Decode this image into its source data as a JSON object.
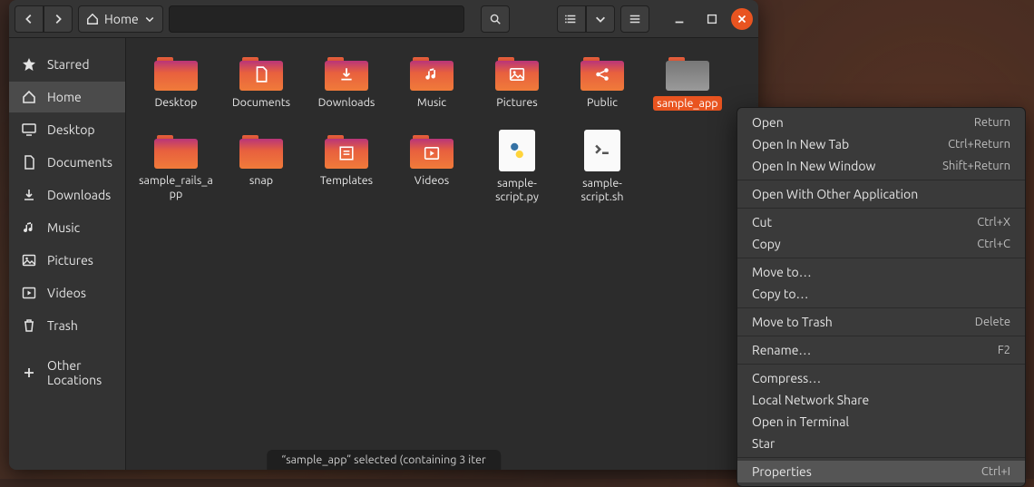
{
  "path_label": "Home",
  "sidebar": [
    {
      "key": "starred",
      "label": "Starred",
      "icon": "star",
      "active": false
    },
    {
      "key": "home",
      "label": "Home",
      "icon": "home",
      "active": true
    },
    {
      "key": "desktop",
      "label": "Desktop",
      "icon": "desktop",
      "active": false
    },
    {
      "key": "documents",
      "label": "Documents",
      "icon": "doc",
      "active": false
    },
    {
      "key": "downloads",
      "label": "Downloads",
      "icon": "down",
      "active": false
    },
    {
      "key": "music",
      "label": "Music",
      "icon": "music",
      "active": false
    },
    {
      "key": "pictures",
      "label": "Pictures",
      "icon": "picture",
      "active": false
    },
    {
      "key": "videos",
      "label": "Videos",
      "icon": "video",
      "active": false
    },
    {
      "key": "trash",
      "label": "Trash",
      "icon": "trash",
      "active": false
    },
    {
      "key": "other",
      "label": "Other Locations",
      "icon": "plus",
      "active": false,
      "section": true
    }
  ],
  "files": [
    {
      "name": "Desktop",
      "type": "folder"
    },
    {
      "name": "Documents",
      "type": "folder",
      "action": "doc"
    },
    {
      "name": "Downloads",
      "type": "folder",
      "action": "down"
    },
    {
      "name": "Music",
      "type": "folder",
      "action": "music"
    },
    {
      "name": "Pictures",
      "type": "folder",
      "action": "picture"
    },
    {
      "name": "Public",
      "type": "folder",
      "action": "share"
    },
    {
      "name": "sample_app",
      "type": "folder",
      "selected": true
    },
    {
      "name": "sample_rails_app",
      "type": "folder"
    },
    {
      "name": "snap",
      "type": "folder"
    },
    {
      "name": "Templates",
      "type": "folder",
      "action": "template"
    },
    {
      "name": "Videos",
      "type": "folder",
      "action": "video"
    },
    {
      "name": "sample-script.py",
      "type": "file",
      "file_icon": "python"
    },
    {
      "name": "sample-script.sh",
      "type": "file",
      "file_icon": "term"
    }
  ],
  "status_text": "“sample_app” selected  (containing 3 iter",
  "context_menu": [
    {
      "label": "Open",
      "accel": "Return"
    },
    {
      "label": "Open In New Tab",
      "accel": "Ctrl+Return"
    },
    {
      "label": "Open In New Window",
      "accel": "Shift+Return"
    },
    {
      "sep": true
    },
    {
      "label": "Open With Other Application"
    },
    {
      "sep": true
    },
    {
      "label": "Cut",
      "accel": "Ctrl+X"
    },
    {
      "label": "Copy",
      "accel": "Ctrl+C"
    },
    {
      "sep": true
    },
    {
      "label": "Move to…"
    },
    {
      "label": "Copy to…"
    },
    {
      "sep": true
    },
    {
      "label": "Move to Trash",
      "accel": "Delete"
    },
    {
      "sep": true
    },
    {
      "label": "Rename…",
      "accel": "F2"
    },
    {
      "sep": true
    },
    {
      "label": "Compress…"
    },
    {
      "label": "Local Network Share"
    },
    {
      "label": "Open in Terminal"
    },
    {
      "label": "Star"
    },
    {
      "sep": true
    },
    {
      "label": "Properties",
      "accel": "Ctrl+I",
      "highlight": true
    }
  ]
}
